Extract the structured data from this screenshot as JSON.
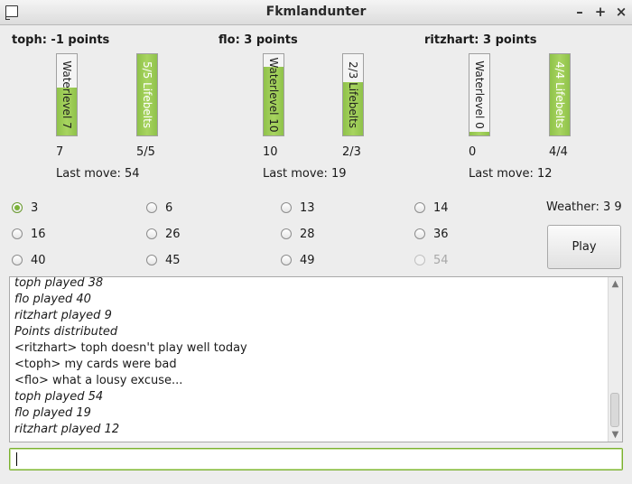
{
  "window": {
    "title": "Fkmlandunter"
  },
  "players": [
    {
      "title": "toph: -1 points",
      "water_text": "Waterlevel 7",
      "water_fraction": 0.59,
      "water_value": "7",
      "life_text": "5/5 Lifebelts",
      "life_fraction": 1.0,
      "life_value": "5/5",
      "last_move": "Last move: 54"
    },
    {
      "title": "flo: 3 points",
      "water_text": "Waterlevel 10",
      "water_fraction": 0.85,
      "water_value": "10",
      "life_text": "2/3 Lifebelts",
      "life_fraction": 0.66,
      "life_value": "2/3",
      "last_move": "Last move: 19"
    },
    {
      "title": "ritzhart: 3 points",
      "water_text": "Waterlevel 0",
      "water_fraction": 0.04,
      "water_value": "0",
      "life_text": "4/4 Lifebelts",
      "life_fraction": 1.0,
      "life_value": "4/4",
      "last_move": "Last move: 12"
    }
  ],
  "cards": [
    {
      "label": "3",
      "checked": true,
      "disabled": false
    },
    {
      "label": "6",
      "checked": false,
      "disabled": false
    },
    {
      "label": "13",
      "checked": false,
      "disabled": false
    },
    {
      "label": "14",
      "checked": false,
      "disabled": false
    },
    {
      "label": "16",
      "checked": false,
      "disabled": false
    },
    {
      "label": "26",
      "checked": false,
      "disabled": false
    },
    {
      "label": "28",
      "checked": false,
      "disabled": false
    },
    {
      "label": "36",
      "checked": false,
      "disabled": false
    },
    {
      "label": "40",
      "checked": false,
      "disabled": false
    },
    {
      "label": "45",
      "checked": false,
      "disabled": false
    },
    {
      "label": "49",
      "checked": false,
      "disabled": false
    },
    {
      "label": "54",
      "checked": false,
      "disabled": true
    }
  ],
  "weather": "Weather: 3 9",
  "play_button": "Play",
  "log": [
    {
      "text": "toph played 38",
      "italic": true
    },
    {
      "text": "flo played 40",
      "italic": true
    },
    {
      "text": "ritzhart played 9",
      "italic": true
    },
    {
      "text": "Points distributed",
      "italic": true
    },
    {
      "text": "<ritzhart> toph doesn't play well today",
      "italic": false
    },
    {
      "text": "<toph> my cards were bad",
      "italic": false
    },
    {
      "text": "<flo> what a lousy excuse...",
      "italic": false
    },
    {
      "text": "toph played 54",
      "italic": true
    },
    {
      "text": "flo played 19",
      "italic": true
    },
    {
      "text": "ritzhart played 12",
      "italic": true
    }
  ],
  "chat_input": {
    "value": ""
  }
}
